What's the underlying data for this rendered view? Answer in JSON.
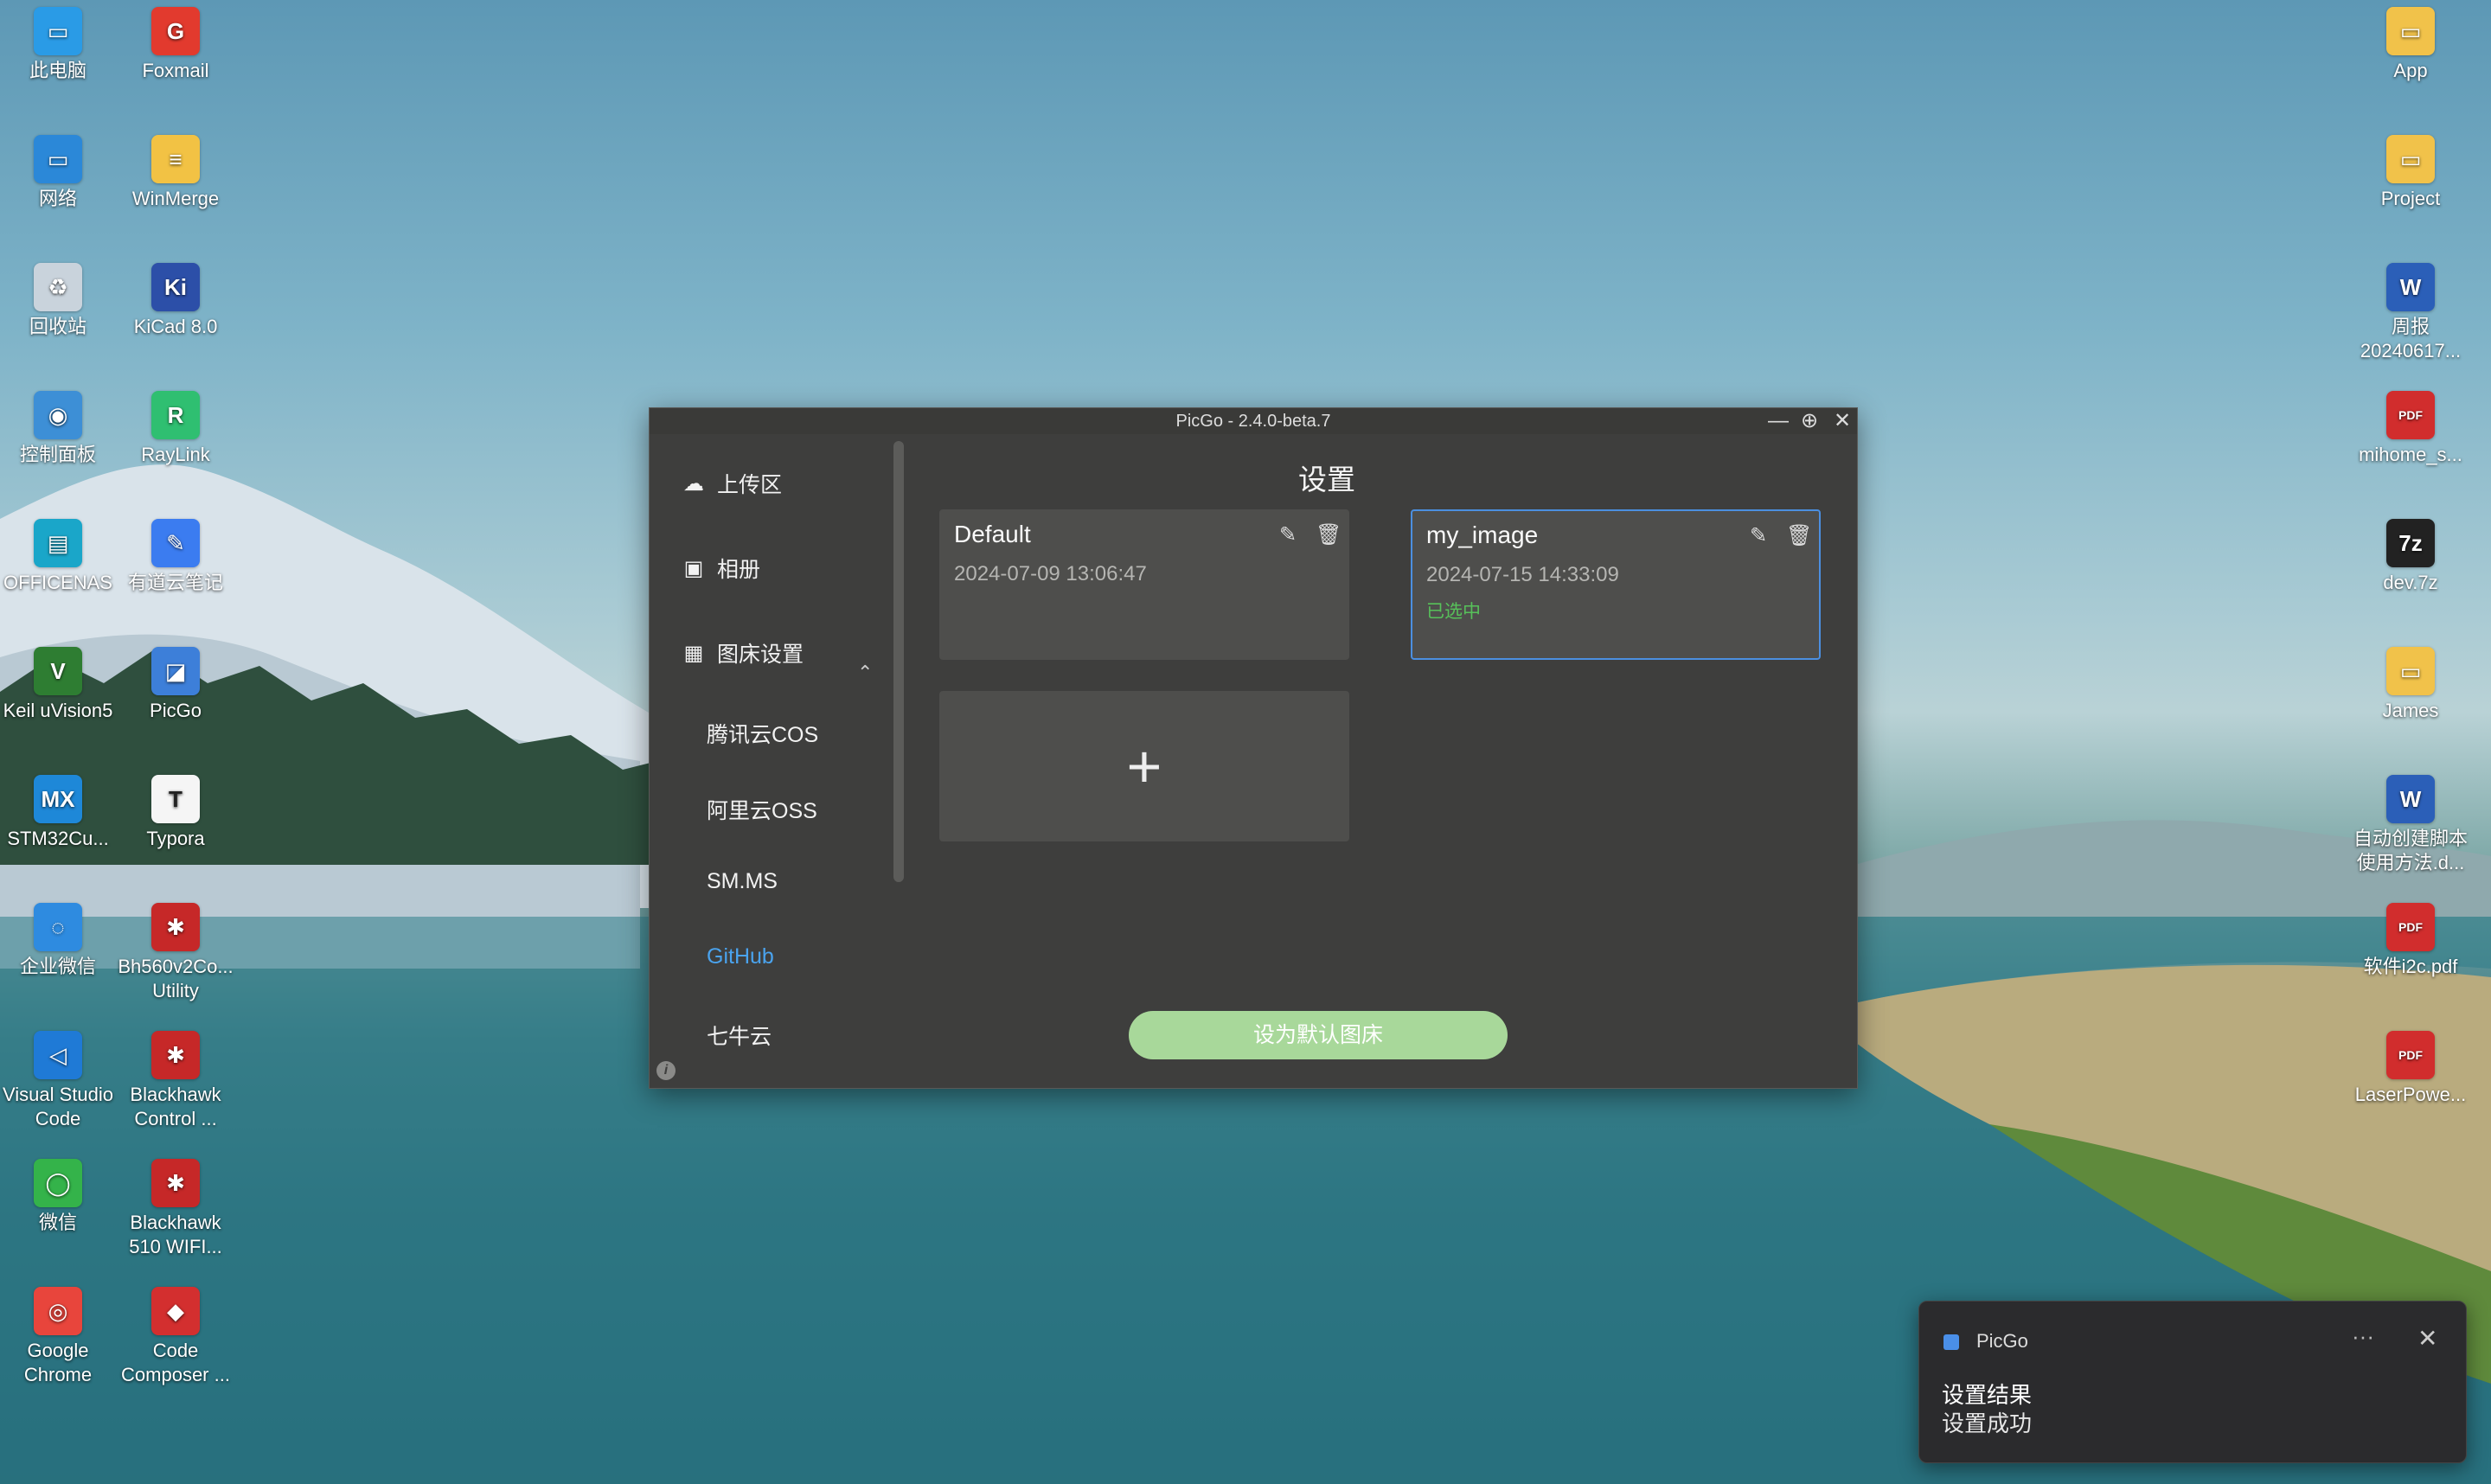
{
  "desktop": {
    "left_icons": [
      {
        "label": "此电脑",
        "icon": "monitor-icon",
        "color": "#2a9be6",
        "glyph": "▭"
      },
      {
        "label": "Foxmail",
        "icon": "foxmail-icon",
        "color": "#e23a2e",
        "glyph": "G"
      },
      {
        "label": "网络",
        "icon": "network-icon",
        "color": "#2b88d8",
        "glyph": "▭"
      },
      {
        "label": "WinMerge",
        "icon": "winmerge-icon",
        "color": "#f2c244",
        "glyph": "≡"
      },
      {
        "label": "回收站",
        "icon": "recycle-bin-icon",
        "color": "#c9d3dc",
        "glyph": "♻"
      },
      {
        "label": "KiCad 8.0",
        "icon": "kicad-icon",
        "color": "#2c4fa8",
        "glyph": "Ki"
      },
      {
        "label": "控制面板",
        "icon": "control-panel-icon",
        "color": "#3d8fd6",
        "glyph": "◉"
      },
      {
        "label": "RayLink",
        "icon": "raylink-icon",
        "color": "#2fbf71",
        "glyph": "R"
      },
      {
        "label": "OFFICENAS",
        "icon": "officenas-icon",
        "color": "#1aa6c9",
        "glyph": "▤"
      },
      {
        "label": "有道云笔记",
        "icon": "youdao-note-icon",
        "color": "#3b7cf0",
        "glyph": "✎"
      },
      {
        "label": "Keil uVision5",
        "icon": "keil-icon",
        "color": "#2e7d32",
        "glyph": "V"
      },
      {
        "label": "PicGo",
        "icon": "picgo-icon",
        "color": "#3d7fd9",
        "glyph": "◪"
      },
      {
        "label": "STM32Cu...",
        "icon": "stm32cube-icon",
        "color": "#1e88d8",
        "glyph": "MX"
      },
      {
        "label": "Typora",
        "icon": "typora-icon",
        "color": "#f5f5f5",
        "glyph": "T"
      },
      {
        "label": "企业微信",
        "icon": "wecom-icon",
        "color": "#2e8be0",
        "glyph": "◌"
      },
      {
        "label": "Bh560v2Co...\nUtility",
        "icon": "blackhawk-utility-icon",
        "color": "#c62828",
        "glyph": "✱"
      },
      {
        "label": "Visual Studio\nCode",
        "icon": "vscode-icon",
        "color": "#1f7ad6",
        "glyph": "◁"
      },
      {
        "label": "Blackhawk\nControl ...",
        "icon": "blackhawk-control-icon",
        "color": "#c62828",
        "glyph": "✱"
      },
      {
        "label": "微信",
        "icon": "wechat-icon",
        "color": "#34b34a",
        "glyph": "◯"
      },
      {
        "label": "Blackhawk\n510 WIFI...",
        "icon": "blackhawk-wifi-icon",
        "color": "#c62828",
        "glyph": "✱"
      },
      {
        "label": "Google\nChrome",
        "icon": "chrome-icon",
        "color": "#e8453c",
        "glyph": "◎"
      },
      {
        "label": "Code\nComposer ...",
        "icon": "code-composer-icon",
        "color": "#d32f2f",
        "glyph": "◆"
      }
    ],
    "right_icons": [
      {
        "label": "App",
        "icon": "folder-icon",
        "color": "#f1c24a",
        "glyph": "▭"
      },
      {
        "label": "Project",
        "icon": "folder-icon",
        "color": "#f1c24a",
        "glyph": "▭"
      },
      {
        "label": "周报\n20240617...",
        "icon": "word-doc-icon",
        "color": "#2b5fb8",
        "glyph": "W"
      },
      {
        "label": "mihome_s...",
        "icon": "pdf-icon",
        "color": "#d12d2d",
        "glyph": "PDF"
      },
      {
        "label": "dev.7z",
        "icon": "7z-archive-icon",
        "color": "#222222",
        "glyph": "7z"
      },
      {
        "label": "James",
        "icon": "folder-icon",
        "color": "#f1c24a",
        "glyph": "▭"
      },
      {
        "label": "自动创建脚本\n使用方法.d...",
        "icon": "word-doc-icon",
        "color": "#2b5fb8",
        "glyph": "W"
      },
      {
        "label": "软件i2c.pdf",
        "icon": "pdf-icon",
        "color": "#d12d2d",
        "glyph": "PDF"
      },
      {
        "label": "LaserPowe...",
        "icon": "pdf-icon",
        "color": "#d12d2d",
        "glyph": "PDF"
      }
    ]
  },
  "window": {
    "title": "PicGo - 2.4.0-beta.7",
    "controls": {
      "minimize": "—",
      "pin": "⊕",
      "close": "✕"
    },
    "nav": [
      {
        "label": "上传区",
        "icon": "cloud-upload-icon",
        "glyph": "☁"
      },
      {
        "label": "相册",
        "icon": "image-icon",
        "glyph": "▣"
      },
      {
        "label": "图床设置",
        "icon": "grid-icon",
        "glyph": "▦"
      }
    ],
    "nav_expand": "⌃",
    "sub_nav": [
      "腾讯云COS",
      "阿里云OSS",
      "SM.MS",
      "GitHub",
      "七牛云"
    ],
    "active_sub": "GitHub",
    "info_glyph": "i",
    "page_title": "设置",
    "cards": [
      {
        "name": "Default",
        "date": "2024-07-09 13:06:47",
        "tag": ""
      },
      {
        "name": "my_image",
        "date": "2024-07-15 14:33:09",
        "tag": "已选中"
      }
    ],
    "edit_glyph": "✎",
    "delete_glyph": "🗑",
    "add_glyph": "+",
    "default_button": "设为默认图床"
  },
  "toast": {
    "app_name": "PicGo",
    "more": "···",
    "close": "✕",
    "title": "设置结果",
    "message": "设置成功"
  },
  "colors": {
    "accent": "#4aa3ee",
    "selected_border": "#4b8fe0",
    "button_green": "#a8d89a",
    "selected_tag": "#57c15a"
  }
}
